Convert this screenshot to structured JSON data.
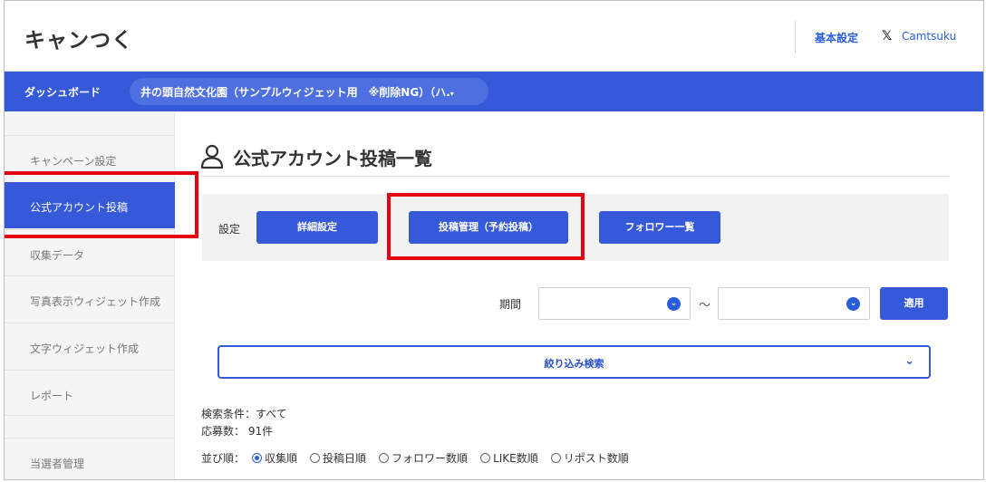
{
  "header": {
    "logo": "キャンつく",
    "basic_settings": "基本設定",
    "x_icon": "𝕏",
    "camtsuku": "Camtsuku"
  },
  "navbar": {
    "dashboard": "ダッシュボード",
    "campaign_select": "井の頭自然文化園（サンプルウィジェット用　※削除NG）（ハ.",
    "caret": "▾"
  },
  "sidebar": {
    "items": [
      {
        "label": "キャンペーン設定"
      },
      {
        "label": "公式アカウント投稿"
      },
      {
        "label": "収集データ"
      },
      {
        "label": "写真表示ウィジェット作成"
      },
      {
        "label": "文字ウィジェット作成"
      },
      {
        "label": "レポート"
      },
      {
        "label": "当選者管理"
      }
    ],
    "active_index": 1
  },
  "main": {
    "title": "公式アカウント投稿一覧",
    "settings": {
      "label": "設定",
      "buttons": [
        "詳細設定",
        "投稿管理（予約投稿）",
        "フォロワー一覧"
      ]
    },
    "period": {
      "label": "期間",
      "tilde": "〜",
      "apply": "適用"
    },
    "filter": {
      "label": "絞り込み検索",
      "chevron": "⌄"
    },
    "search_condition": "検索条件：すべて",
    "applicants": "応募数： 91件",
    "sort": {
      "label": "並び順：",
      "options": [
        "収集順",
        "投稿日順",
        "フォロワー数順",
        "LIKE数順",
        "リポスト数順"
      ],
      "selected_index": 0
    }
  },
  "colors": {
    "brand_blue": "#3559d8",
    "highlight_red": "#e60012"
  }
}
